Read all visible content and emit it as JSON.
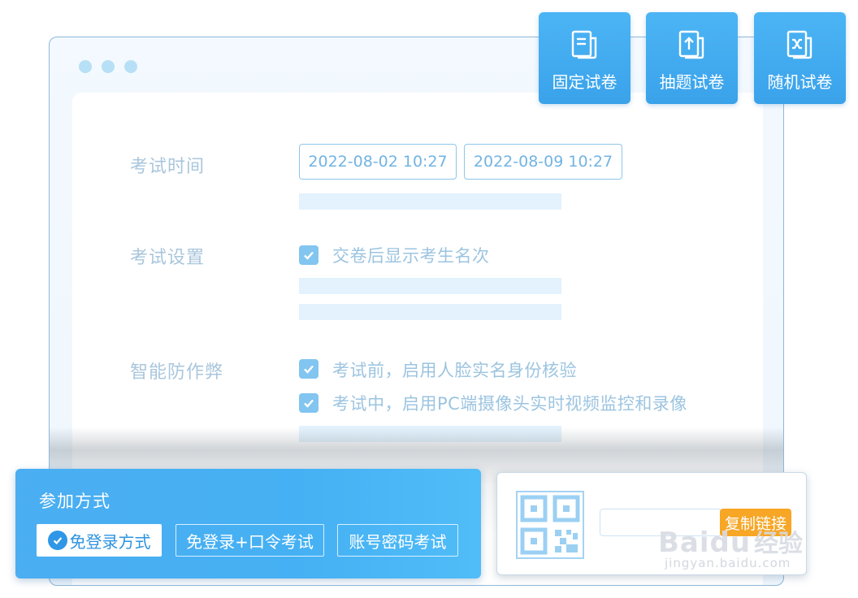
{
  "exam_types": [
    {
      "label": "固定试卷",
      "icon": "document-icon"
    },
    {
      "label": "抽题试卷",
      "icon": "upload-document-icon"
    },
    {
      "label": "随机试卷",
      "icon": "shuffle-document-icon"
    }
  ],
  "form": {
    "time_label": "考试时间",
    "start_time": "2022-08-02 10:27",
    "end_time": "2022-08-09 10:27",
    "settings_label": "考试设置",
    "show_rank": "交卷后显示考生名次",
    "anticheat_label": "智能防作弊",
    "face_verify": "考试前，启用人脸实名身份核验",
    "camera_monitor": "考试中，启用PC端摄像头实时视频监控和录像"
  },
  "join": {
    "title": "参加方式",
    "options": [
      "免登录方式",
      "免登录+口令考试",
      "账号密码考试"
    ]
  },
  "share": {
    "copy_label": "复制链接"
  },
  "watermark": {
    "brand": "Baidu",
    "brand_suffix": "经验",
    "url": "jingyan.baidu.com"
  },
  "colors": {
    "accent": "#3aa2ea",
    "copy_button": "#f7a626"
  }
}
